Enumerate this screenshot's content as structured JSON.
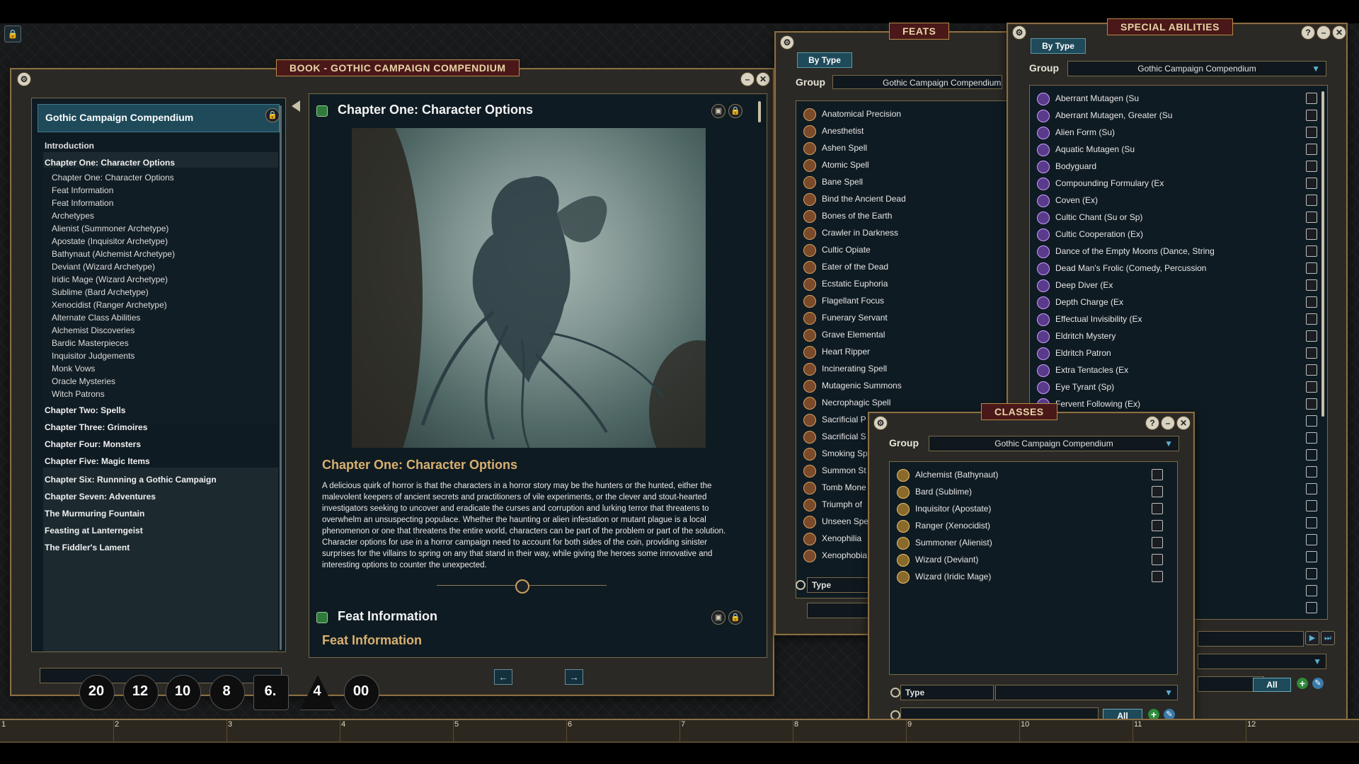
{
  "book": {
    "title": "BOOK - GOTHIC CAMPAIGN COMPENDIUM",
    "toc_header": "Gothic Campaign Compendium",
    "toc": [
      {
        "kind": "item",
        "label": "Introduction"
      },
      {
        "kind": "chap",
        "label": "Chapter One: Character Options"
      },
      {
        "kind": "sub",
        "label": "Chapter One: Character Options"
      },
      {
        "kind": "sub",
        "label": "Feat Information"
      },
      {
        "kind": "sub",
        "label": "Feat Information"
      },
      {
        "kind": "sub",
        "label": "Archetypes"
      },
      {
        "kind": "sub",
        "label": "Alienist (Summoner Archetype)"
      },
      {
        "kind": "sub",
        "label": "Apostate (Inquisitor Archetype)"
      },
      {
        "kind": "sub",
        "label": "Bathynaut (Alchemist Archetype)"
      },
      {
        "kind": "sub",
        "label": "Deviant (Wizard Archetype)"
      },
      {
        "kind": "sub",
        "label": "Iridic Mage (Wizard Archetype)"
      },
      {
        "kind": "sub",
        "label": "Sublime (Bard Archetype)"
      },
      {
        "kind": "sub",
        "label": "Xenocidist (Ranger Archetype)"
      },
      {
        "kind": "sub",
        "label": "Alternate Class Abilities"
      },
      {
        "kind": "sub",
        "label": "Alchemist Discoveries"
      },
      {
        "kind": "sub",
        "label": "Bardic Masterpieces"
      },
      {
        "kind": "sub",
        "label": "Inquisitor Judgements"
      },
      {
        "kind": "sub",
        "label": "Monk Vows"
      },
      {
        "kind": "sub",
        "label": "Oracle Mysteries"
      },
      {
        "kind": "sub",
        "label": "Witch Patrons"
      },
      {
        "kind": "chap",
        "label": "Chapter Two: Spells"
      },
      {
        "kind": "chap",
        "label": "Chapter Three: Grimoires"
      },
      {
        "kind": "chap",
        "label": "Chapter Four: Monsters"
      },
      {
        "kind": "chap",
        "label": "Chapter Five: Magic Items"
      },
      {
        "kind": "chap",
        "label": "Chapter Six: Runnning a Gothic Campaign"
      },
      {
        "kind": "chap",
        "label": "Chapter Seven: Adventures"
      },
      {
        "kind": "chap",
        "label": "The Murmuring Fountain"
      },
      {
        "kind": "chap",
        "label": "Feasting at Lanterngeist"
      },
      {
        "kind": "chap",
        "label": "The Fiddler's Lament"
      }
    ],
    "section_title": "Chapter One: Character Options",
    "content_subtitle": "Chapter One: Character Options",
    "content_paragraph": "A delicious quirk of horror is that the characters in a horror story may be the hunters or the hunted, either the malevolent keepers of ancient secrets and practitioners of vile experiments, or the clever and stout-hearted investigators seeking to uncover and eradicate the curses and corruption and lurking terror that threatens to overwhelm an unsuspecting populace. Whether the haunting or alien infestation or mutant plague is a local phenomenon or one that threatens the entire world, characters can be part of the problem or part of the solution. Character options for use in a horror campaign need to account for both sides of the coin, providing sinister surprises for the villains to spring on any that stand in their way, while giving the heroes some innovative and interesting options to counter the unexpected.",
    "section2_title": "Feat Information",
    "section2_subtitle": "Feat Information",
    "prev_arrow": "←",
    "next_arrow": "→"
  },
  "feats": {
    "title": "FEATS",
    "tab": "By Type",
    "group_label": "Group",
    "group_value": "Gothic Campaign Compendium",
    "items": [
      "Anatomical Precision",
      "Anesthetist",
      "Ashen Spell",
      "Atomic Spell",
      "Bane Spell",
      "Bind the Ancient Dead",
      "Bones of the Earth",
      "Crawler in Darkness",
      "Cultic Opiate",
      "Eater of the Dead",
      "Ecstatic Euphoria",
      "Flagellant Focus",
      "Funerary Servant",
      "Grave Elemental",
      "Heart Ripper",
      "Incinerating Spell",
      "Mutagenic Summons",
      "Necrophagic Spell",
      "Sacrificial P",
      "Sacrificial S",
      "Smoking Sp",
      "Summon St",
      "Tomb Mone",
      "Triumph of",
      "Unseen Spe",
      "Xenophilia",
      "Xenophobia"
    ],
    "filter_label": "Type"
  },
  "special": {
    "title": "SPECIAL ABILITIES",
    "tab": "By Type",
    "group_label": "Group",
    "group_value": "Gothic Campaign Compendium",
    "items": [
      "Aberrant Mutagen (Su",
      "Aberrant Mutagen, Greater (Su",
      "Alien Form (Su)",
      "Aquatic Mutagen (Su",
      "Bodyguard",
      "Compounding Formulary (Ex",
      "Coven (Ex)",
      "Cultic Chant (Su or Sp)",
      "Cultic Cooperation (Ex)",
      "Dance of the Empty Moons (Dance, String",
      "Dead Man's Frolic (Comedy, Percussion",
      "Deep Diver (Ex",
      "Depth Charge (Ex",
      "Effectual Invisibility (Ex",
      "Eldritch Mystery",
      "Eldritch Patron",
      "Extra Tentacles (Ex",
      "Eye Tyrant (Sp)",
      "Fervent Following (Ex)"
    ],
    "all_button": "All"
  },
  "classes": {
    "title": "CLASSES",
    "group_label": "Group",
    "group_value": "Gothic Campaign Compendium",
    "items": [
      "Alchemist (Bathynaut)",
      "Bard (Sublime)",
      "Inquisitor (Apostate)",
      "Ranger (Xenocidist)",
      "Summoner (Alienist)",
      "Wizard (Deviant)",
      "Wizard (Iridic Mage)"
    ],
    "filter_label": "Type",
    "all_button": "All"
  },
  "dice": [
    "20",
    "12",
    "10",
    "8",
    "6.",
    "4",
    "00"
  ],
  "hotbar": [
    "1",
    "2",
    "3",
    "4",
    "5",
    "6",
    "7",
    "8",
    "9",
    "10",
    "11",
    "12"
  ],
  "colors": {
    "accent": "#1e4a5a",
    "frame": "#8a6f45",
    "title_bg": "#4a1818",
    "subtitle": "#d9b070"
  }
}
